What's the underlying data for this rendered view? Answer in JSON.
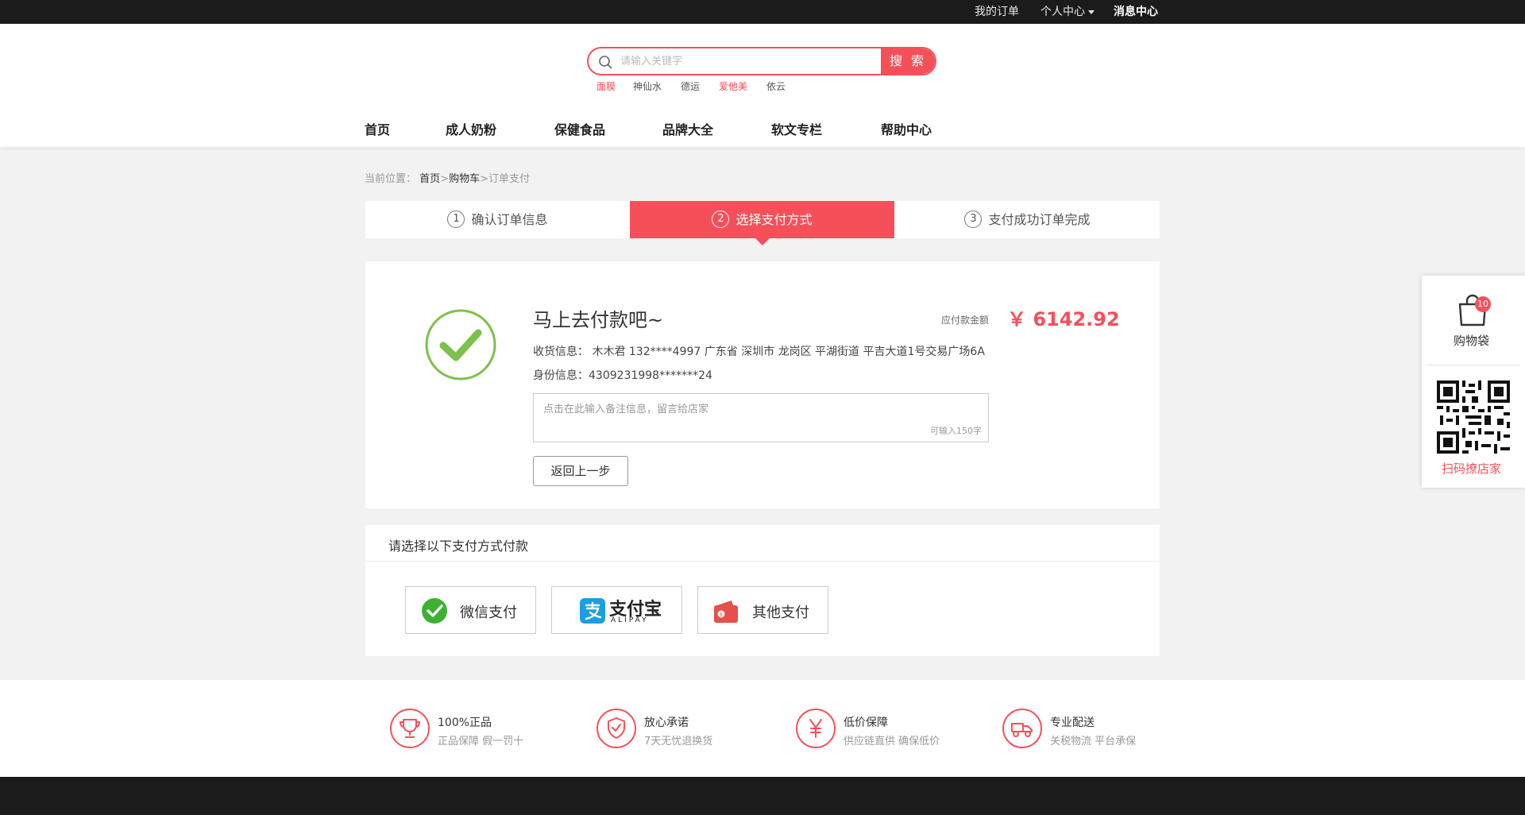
{
  "topbar": {
    "my_orders": "我的订单",
    "personal_center": "个人中心",
    "message_center": "消息中心"
  },
  "search": {
    "placeholder": "请输入关键字",
    "button": "搜 索",
    "hot_keywords": [
      "面膜",
      "神仙水",
      "德运",
      "爱他美",
      "依云"
    ]
  },
  "nav": [
    "首页",
    "成人奶粉",
    "保健食品",
    "品牌大全",
    "软文专栏",
    "帮助中心"
  ],
  "breadcrumb": {
    "prefix": "当前位置：",
    "home": "首页",
    "sep1": ">",
    "cart": "购物车",
    "sep2": ">",
    "current": "订单支付"
  },
  "steps": [
    {
      "num": "1",
      "label": "确认订单信息"
    },
    {
      "num": "2",
      "label": "选择支付方式"
    },
    {
      "num": "3",
      "label": "支付成功订单完成"
    }
  ],
  "order": {
    "title": "马上去付款吧~",
    "amount_label": "应付款金额",
    "amount": "￥ 6142.92",
    "receiver_label": "收货信息：",
    "receiver_value": "木木君  132****4997   广东省 深圳市 龙岗区 平湖街道 平吉大道1号交易广场6A",
    "id_label": "身份信息：",
    "id_value": "4309231998*******24",
    "remark_placeholder": "点击在此输入备注信息，留言给店家",
    "remark_limit": "可输入150字",
    "back_button": "返回上一步"
  },
  "payment": {
    "title": "请选择以下支付方式付款",
    "wechat": "微信支付",
    "alipay_cn": "支付宝",
    "alipay_en": "ALIPAY",
    "other": "其他支付"
  },
  "guarantees": [
    {
      "title": "100%正品",
      "subtitle": "正品保障   假一罚十"
    },
    {
      "title": "放心承诺",
      "subtitle": "7天无忧退换货"
    },
    {
      "title": "低价保障",
      "subtitle": "供应链直供   确保低价"
    },
    {
      "title": "专业配送",
      "subtitle": "关税物流 平台承保"
    }
  ],
  "sidebar": {
    "cart_label": "购物袋",
    "cart_count": "10",
    "qr_label": "扫码撩店家"
  },
  "colors": {
    "accent": "#f5505a",
    "topbar": "#1b1b1b",
    "success_green": "#7dc04b",
    "wechat_green": "#3eb135",
    "alipay_blue": "#1a9fe0",
    "other_red": "#e5504a"
  }
}
